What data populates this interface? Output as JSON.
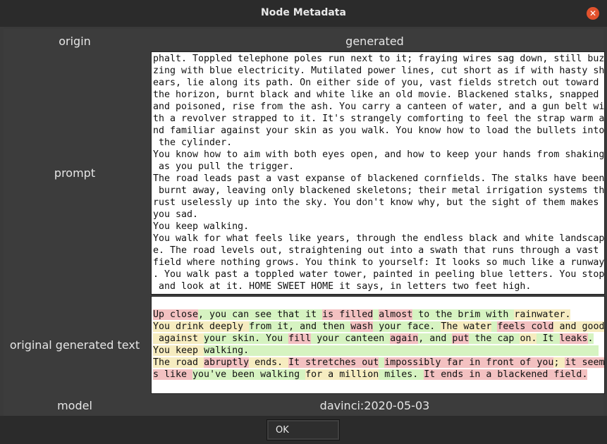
{
  "window": {
    "title": "Node Metadata",
    "close_icon": "close-icon"
  },
  "labels": {
    "origin": "origin",
    "origin_value": "generated",
    "prompt": "prompt",
    "original_generated_text": "original generated text",
    "model": "model",
    "model_value": "davinci:2020-05-03"
  },
  "prompt_lines": [
    "phalt. Toppled telephone poles run next to it; fraying wires sag down, still buz",
    "zing with blue electricity. Mutilated power lines, cut short as if with hasty sh",
    "ears, lie along its path. On either side of you, vast fields stretch out toward",
    "the horizon, burnt black and white like an old movie. Blackened stalks, snapped",
    "and poisoned, rise from the ash. You carry a canteen of water, and a gun belt wi",
    "th a revolver strapped to it. It's strangely comforting to feel the strap warm a",
    "nd familiar against your skin as you walk. You know how to load the bullets into",
    " the cylinder.",
    "You know how to aim with both eyes open, and how to keep your hands from shaking",
    " as you pull the trigger.",
    "The road leads past a vast expanse of blackened cornfields. The stalks have been",
    " burnt away, leaving only blackened skeletons; their metal irrigation systems th",
    "rust uselessly up into the sky. You don't know why, but the sight of them makes",
    "you sad.",
    "You keep walking.",
    "You walk for what feels like years, through the endless black and white landscap",
    "e. The road levels out, straightening out into a swath that runs through a vast",
    "field where nothing grows. You think to yourself: It looks so much like a runway",
    ". You walk past a toppled water tower, painted in peeling blue letters. You stop",
    " and look at it. HOME SWEET HOME it says, in letters two feet high."
  ],
  "generated_lines": [
    [
      [
        "Up close",
        "r"
      ],
      [
        ", you can see that it ",
        "g"
      ],
      [
        "is filled",
        "r"
      ],
      [
        " ",
        "g"
      ],
      [
        "almost",
        "r"
      ],
      [
        " to the brim with ",
        "g"
      ],
      [
        "rainwater.",
        "y"
      ]
    ],
    [
      [
        "You drink deeply ",
        "y"
      ],
      [
        "from it, and then ",
        "g"
      ],
      [
        "wash",
        "r"
      ],
      [
        " your face. ",
        "g"
      ],
      [
        "The water",
        "y"
      ],
      [
        " ",
        "g"
      ],
      [
        "feels cold",
        "r"
      ],
      [
        " and good",
        "y"
      ]
    ],
    [
      [
        " against ",
        "y"
      ],
      [
        "your skin. You ",
        "g"
      ],
      [
        "fill",
        "r"
      ],
      [
        " your canteen ",
        "g"
      ],
      [
        "again",
        "r"
      ],
      [
        ", and ",
        "g"
      ],
      [
        "put",
        "r"
      ],
      [
        " the cap ",
        "g"
      ],
      [
        "on.",
        "y"
      ],
      [
        " It ",
        "g"
      ],
      [
        "leaks",
        "r"
      ],
      [
        ".",
        "g"
      ]
    ],
    [
      [
        "You keep ",
        "y"
      ],
      [
        "walking.                                                              ",
        "g"
      ]
    ],
    [
      [
        "The road ",
        "y"
      ],
      [
        "abruptly",
        "r"
      ],
      [
        " ends. ",
        "y"
      ],
      [
        "It stretches out",
        "r"
      ],
      [
        " ",
        "g"
      ],
      [
        "impossibly far in front of you",
        "r"
      ],
      [
        "; ",
        "y"
      ],
      [
        "it seem",
        "r"
      ]
    ],
    [
      [
        "s like ",
        "r"
      ],
      [
        "you've been walking ",
        "g"
      ],
      [
        "for a million",
        "y"
      ],
      [
        " miles. ",
        "g"
      ],
      [
        "It ends in a ",
        "r"
      ],
      [
        "blackened field.",
        "r"
      ]
    ]
  ],
  "buttons": {
    "ok": "OK"
  },
  "colors": {
    "highlight_red": "#f3c1c1",
    "highlight_green": "#d6f3c1",
    "highlight_yellow": "#f6ecc0",
    "close": "#e2522d"
  }
}
